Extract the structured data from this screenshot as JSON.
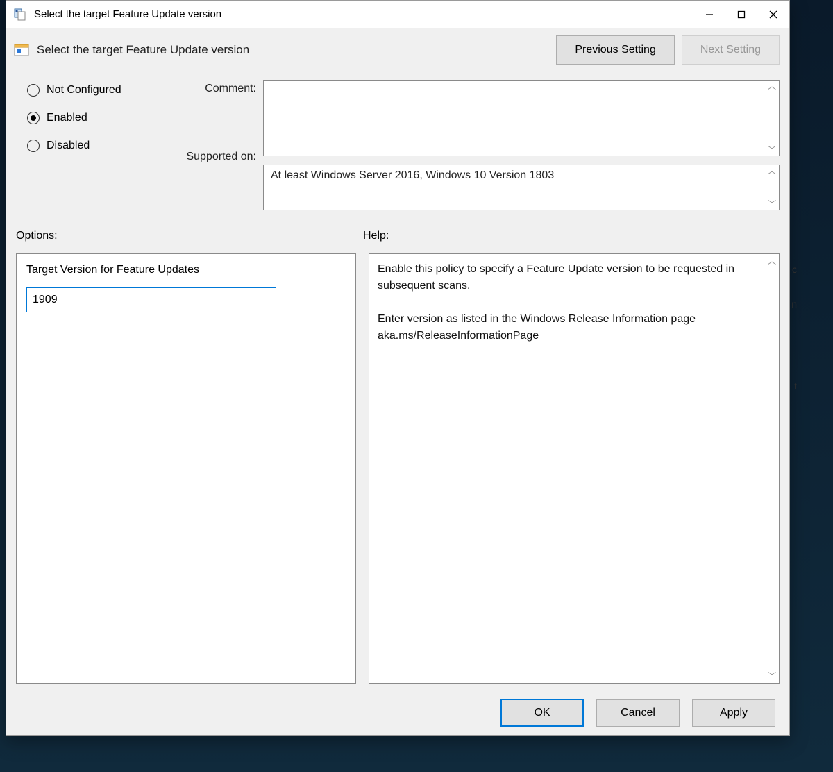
{
  "titlebar": {
    "title": "Select the target Feature Update version"
  },
  "header": {
    "policy_name": "Select the target Feature Update version",
    "previous_label": "Previous Setting",
    "next_label": "Next Setting"
  },
  "state": {
    "options": {
      "not_configured": "Not Configured",
      "enabled": "Enabled",
      "disabled": "Disabled"
    },
    "selected": "enabled"
  },
  "labels": {
    "comment": "Comment:",
    "supported_on": "Supported on:",
    "options": "Options:",
    "help": "Help:"
  },
  "fields": {
    "comment_value": "",
    "supported_on_value": "At least Windows Server 2016, Windows 10 Version 1803"
  },
  "options_pane": {
    "label": "Target Version for Feature Updates",
    "value": "1909"
  },
  "help_pane": {
    "p1": "Enable this policy to specify a Feature Update version to be requested in subsequent scans.",
    "p2": "Enter version as listed in the Windows Release Information page aka.ms/ReleaseInformationPage"
  },
  "footer": {
    "ok": "OK",
    "cancel": "Cancel",
    "apply": "Apply"
  }
}
